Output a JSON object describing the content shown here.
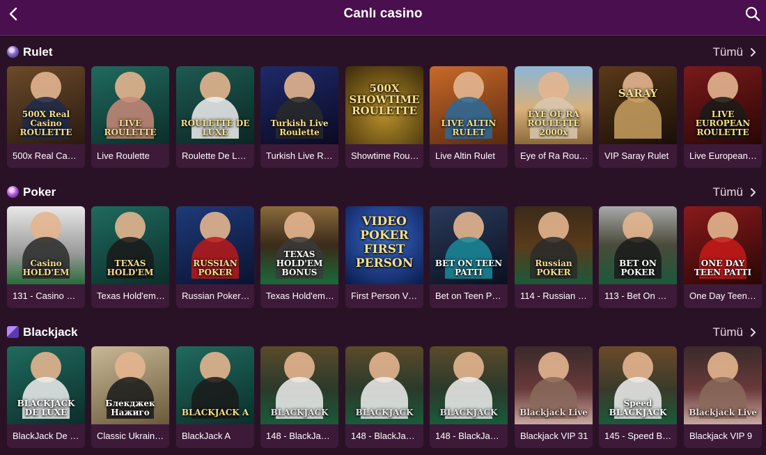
{
  "header": {
    "title": "Canlı casino"
  },
  "colors": {
    "header_bg": "#4a0f4e",
    "page_bg": "#2a1226",
    "card_bg": "#3d1a38"
  },
  "sections": [
    {
      "title": "Rulet",
      "icon": "roulette-icon",
      "all_label": "Tümü",
      "games": [
        {
          "label": "500x Real Casi...",
          "logo": "500X Real Casino ROULETTE"
        },
        {
          "label": "Live Roulette",
          "logo": "LIVE ROULETTE"
        },
        {
          "label": "Roulette De Luxe",
          "logo": "ROULETTE DE LUXE"
        },
        {
          "label": "Turkish Live Ro...",
          "logo": "Turkish Live Roulette"
        },
        {
          "label": "Showtime Roul...",
          "logo": "500X SHOWTIME ROULETTE"
        },
        {
          "label": "Live Altin Rulet",
          "logo": "LIVE ALTIN RULET"
        },
        {
          "label": "Eye of Ra Roule...",
          "logo": "EYE OF RA ROULETTE 2000x"
        },
        {
          "label": "VIP Saray Rulet",
          "logo": "SARAY"
        },
        {
          "label": "Live European R...",
          "logo": "LIVE EUROPEAN ROULETTE"
        }
      ]
    },
    {
      "title": "Poker",
      "icon": "poker-chip-icon",
      "all_label": "Tümü",
      "games": [
        {
          "label": "131 - Casino Ho...",
          "logo": "Casino HOLD'EM"
        },
        {
          "label": "Texas Hold'em ...",
          "logo": "TEXAS HOLD'EM"
        },
        {
          "label": "Russian Poker ...",
          "logo": "RUSSIAN POKER"
        },
        {
          "label": "Texas Hold'em ...",
          "logo": "TEXAS HOLD'EM BONUS"
        },
        {
          "label": "First Person Vid...",
          "logo": "VIDEO POKER FIRST PERSON"
        },
        {
          "label": "Bet on Teen Patti",
          "logo": "BET ON TEEN PATTI"
        },
        {
          "label": "114 - Russian P...",
          "logo": "Russian POKER"
        },
        {
          "label": "113 - Bet On Po...",
          "logo": "BET ON POKER"
        },
        {
          "label": "One Day Teen P...",
          "logo": "ONE DAY TEEN PATTI"
        }
      ]
    },
    {
      "title": "Blackjack",
      "icon": "cards-icon",
      "all_label": "Tümü",
      "games": [
        {
          "label": "BlackJack De L...",
          "logo": "BLACKJACK DE LUXE"
        },
        {
          "label": "Classic Ukrainia...",
          "logo": "Блекджек Нажиго"
        },
        {
          "label": "BlackJack A",
          "logo": "BLACKJACK A"
        },
        {
          "label": "148 - BlackJack...",
          "logo": "BLACKJACK"
        },
        {
          "label": "148 - BlackJack...",
          "logo": "BLACKJACK"
        },
        {
          "label": "148 - BlackJack...",
          "logo": "BLACKJACK"
        },
        {
          "label": "Blackjack VIP 31",
          "logo": "Blackjack Live"
        },
        {
          "label": "145 - Speed Bla...",
          "logo": "Speed BLACKJACK"
        },
        {
          "label": "Blackjack VIP 9",
          "logo": "Blackjack Live"
        }
      ]
    }
  ]
}
